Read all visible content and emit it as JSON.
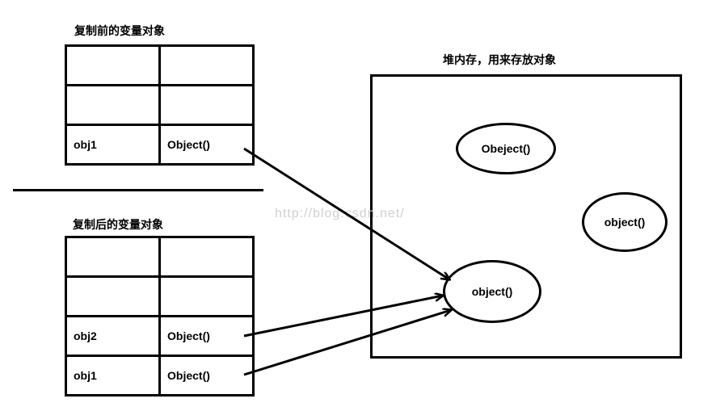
{
  "titles": {
    "before": "复制前的变量对象",
    "after": "复制后的变量对象",
    "heap": "堆内存，用来存放对象"
  },
  "tables": {
    "before": {
      "rows": [
        {
          "c1": "",
          "c2": ""
        },
        {
          "c1": "",
          "c2": ""
        },
        {
          "c1": "obj1",
          "c2": "Object()"
        }
      ]
    },
    "after": {
      "rows": [
        {
          "c1": "",
          "c2": ""
        },
        {
          "c1": "",
          "c2": ""
        },
        {
          "c1": "obj2",
          "c2": "Object()"
        },
        {
          "c1": "obj1",
          "c2": "Object()"
        }
      ]
    }
  },
  "heap": {
    "objects": {
      "o1": "Obeject()",
      "o2": "object()",
      "o3": "object()"
    }
  },
  "watermark": "http://blog.csdn.net/"
}
